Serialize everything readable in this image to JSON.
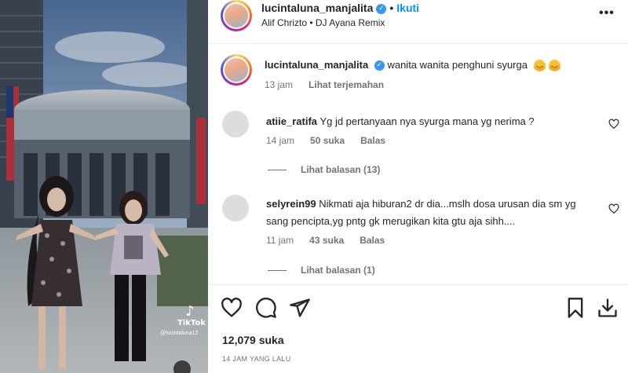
{
  "media": {
    "watermark_logo": "TikTok",
    "watermark_handle": "@lucintaluna12",
    "music_note_icon": "music-note-icon",
    "mute_icon": "speaker-muted-icon"
  },
  "header": {
    "username": "lucintaluna_manjalita",
    "separator": "•",
    "follow_label": "Ikuti",
    "audio": "Alif Chrizto • DJ Ayana Remix",
    "more_icon": "more-options-icon"
  },
  "caption": {
    "username": "lucintaluna_manjalita",
    "text": "wanita wanita penghuni syurga",
    "time": "13 jam",
    "translate_label": "Lihat terjemahan"
  },
  "comments": [
    {
      "username": "atiie_ratifa",
      "text": "Yg jd pertanyaan nya syurga mana yg nerima ?",
      "time": "14 jam",
      "likes": "50 suka",
      "reply_label": "Balas",
      "view_replies": "Lihat balasan (13)"
    },
    {
      "username": "selyrein99",
      "text": "Nikmati aja hiburan2 dr dia...mslh dosa urusan dia sm yg sang pencipta,yg pntg gk merugikan kita gtu aja sihh....",
      "time": "11 jam",
      "likes": "43 suka",
      "reply_label": "Balas",
      "view_replies": "Lihat balasan (1)"
    }
  ],
  "actions": {
    "like_icon": "heart-icon",
    "comment_icon": "comment-icon",
    "share_icon": "share-icon",
    "save_icon": "bookmark-icon",
    "download_icon": "download-icon"
  },
  "likes_count": "12,079 suka",
  "timestamp": "14 JAM YANG LALU",
  "colors": {
    "link_blue": "#0095f6",
    "verified_blue": "#3897f0",
    "text": "#262626",
    "muted": "#737373"
  }
}
